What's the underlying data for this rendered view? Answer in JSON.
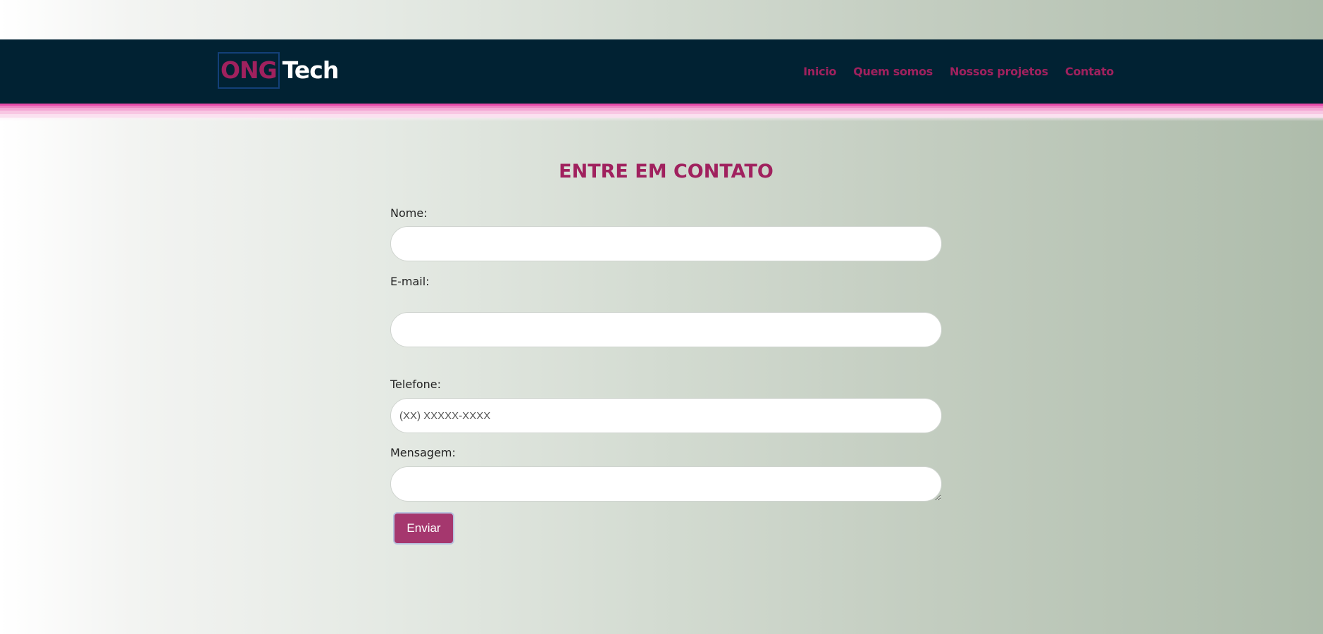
{
  "header": {
    "logo_highlight": "ONG",
    "logo_text": "Tech",
    "nav": [
      "Inicio",
      "Quem somos",
      "Nossos projetos",
      "Contato"
    ]
  },
  "form": {
    "title": "ENTRE EM CONTATO",
    "name_label": "Nome:",
    "email_label": "E-mail:",
    "phone_label": "Telefone:",
    "phone_placeholder": "(XX) XXXXX-XXXX",
    "message_label": "Mensagem:",
    "submit_label": "Enviar"
  },
  "colors": {
    "header_bg": "#012233",
    "accent": "#a0215e",
    "button_bg": "#a5376e",
    "stripe": "#e64aa8"
  }
}
